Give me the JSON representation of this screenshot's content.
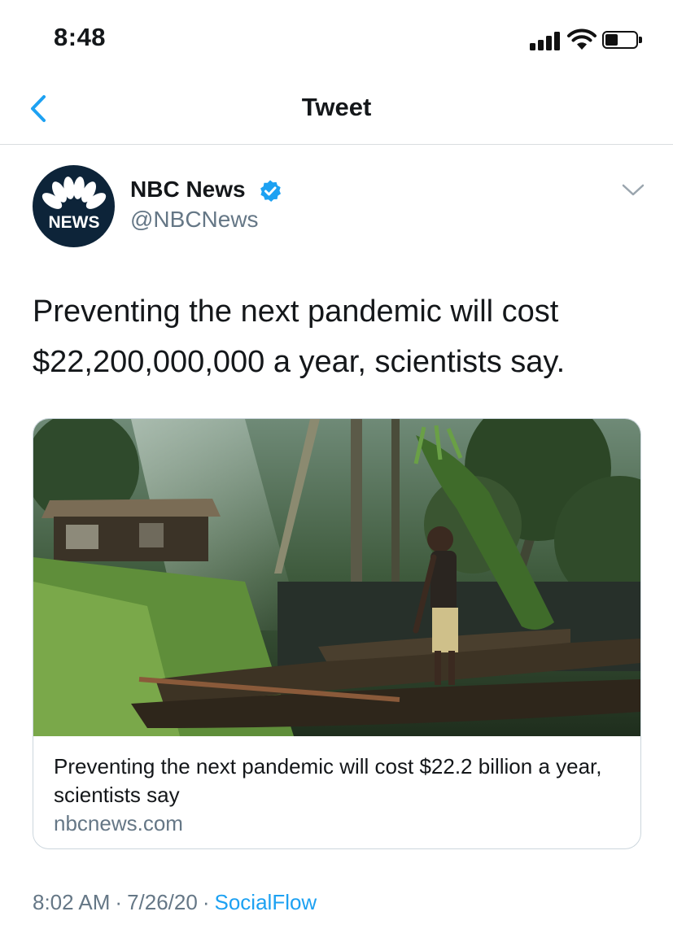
{
  "status_bar": {
    "time": "8:48",
    "icons": [
      "cellular-signal-icon",
      "wifi-icon",
      "battery-icon"
    ]
  },
  "nav": {
    "title": "Tweet",
    "back_icon": "chevron-left-icon",
    "accent_color": "#1da1f2"
  },
  "tweet": {
    "author_name": "NBC News",
    "author_handle": "@NBCNews",
    "verified": true,
    "avatar_text": "NEWS",
    "text": "Preventing the next pandemic will cost $22,200,000,000 a year, scientists say.",
    "card": {
      "title": "Preventing the next pandemic will cost $22.2 billion a year, scientists say",
      "domain": "nbcnews.com"
    },
    "time": "8:02 AM",
    "date": "7/26/20",
    "separator": "·",
    "source": "SocialFlow"
  },
  "colors": {
    "text_primary": "#14171a",
    "text_secondary": "#657786",
    "link": "#1da1f2",
    "divider": "#d9dde0",
    "avatar_bg": "#0d2439"
  }
}
